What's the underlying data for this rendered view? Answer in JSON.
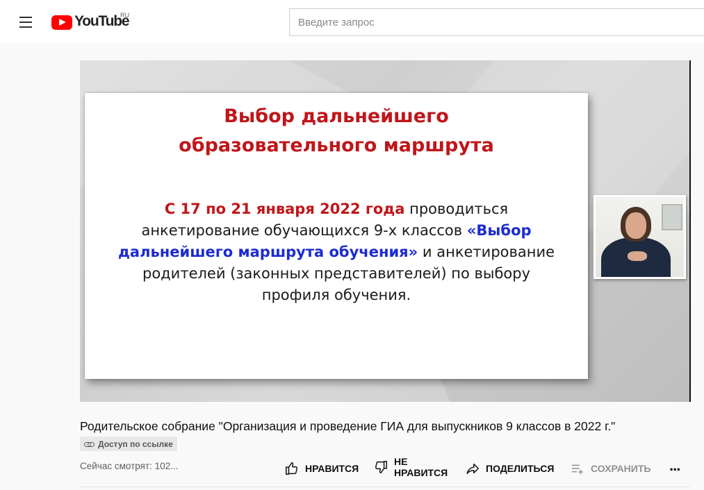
{
  "header": {
    "logo_text": "YouTube",
    "logo_country": "RU",
    "search_placeholder": "Введите запрос"
  },
  "player": {
    "slide": {
      "title_line1": "Выбор дальнейшего",
      "title_line2": "образовательного маршрута",
      "body_red": "С 17 по 21 января 2022 года",
      "body_part1": " проводиться анкетирование обучающихся 9-х классов ",
      "body_blue": "«Выбор дальнейшего маршрута обучения»",
      "body_part2": "  и анкетирование родителей (законных представителей) по выбору профиля обучения."
    }
  },
  "video": {
    "title": "Родительское собрание \"Организация и проведение ГИА для выпускников 9 классов в 2022 г.\"",
    "badge": "Доступ по ссылке",
    "viewers": "Сейчас смотрят: 102..."
  },
  "actions": {
    "like": "НРАВИТСЯ",
    "dislike_line1": "НЕ",
    "dislike_line2": "НРАВИТСЯ",
    "share": "ПОДЕЛИТЬСЯ",
    "save": "СОХРАНИТЬ",
    "more": "..."
  },
  "colors": {
    "brand_red": "#ff0000",
    "slide_red": "#c0161a",
    "slide_blue": "#1d2bd1"
  }
}
